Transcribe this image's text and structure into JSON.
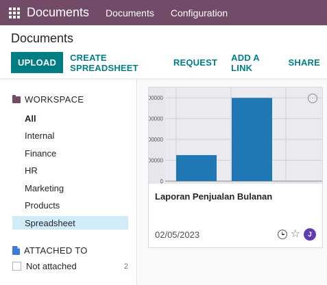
{
  "navbar": {
    "app_name": "Documents",
    "menu": [
      "Documents",
      "Configuration"
    ]
  },
  "breadcrumb": "Documents",
  "toolbar": {
    "upload": "UPLOAD",
    "create_spreadsheet": "CREATE SPREADSHEET",
    "request": "REQUEST",
    "add_link": "ADD A LINK",
    "share": "SHARE"
  },
  "sidebar": {
    "workspace_heading": "WORKSPACE",
    "workspaces": [
      "All",
      "Internal",
      "Finance",
      "HR",
      "Marketing",
      "Products",
      "Spreadsheet"
    ],
    "active_workspace": "Spreadsheet",
    "attached_heading": "ATTACHED TO",
    "attached_filter": {
      "label": "Not attached",
      "count": "2"
    }
  },
  "document_card": {
    "name": "Laporan Penjualan Bulanan",
    "date": "02/05/2023",
    "avatar_initial": "J",
    "avatar_color": "#5e3ab5"
  },
  "chart_data": {
    "type": "bar",
    "categories": [
      "",
      ""
    ],
    "values": [
      12500,
      40000
    ],
    "y_tick_labels": [
      "0",
      "00000",
      "00000",
      "00000",
      "00000"
    ],
    "ylim": [
      0,
      45000
    ],
    "grid": true,
    "bar_color": "#1f77b4"
  },
  "colors": {
    "navbar": "#714b67",
    "primary": "#017e84",
    "active_item": "#d1ecf8"
  }
}
